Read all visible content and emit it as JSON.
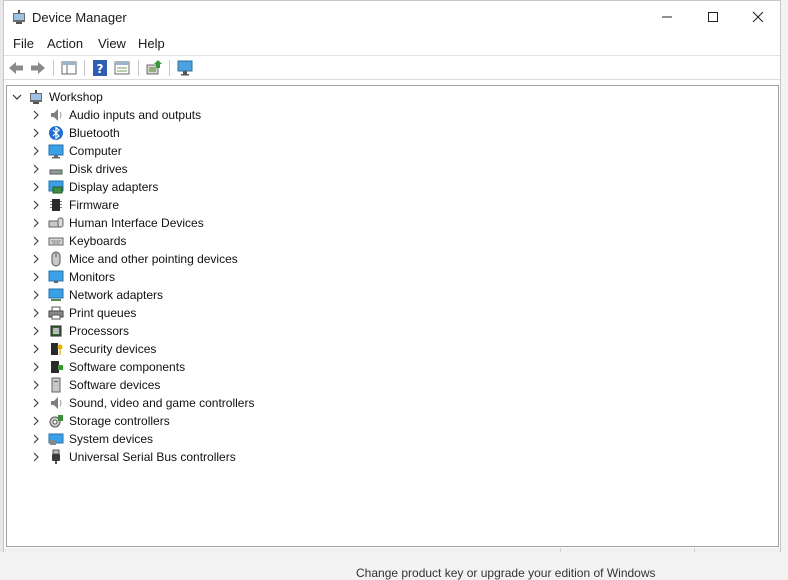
{
  "window": {
    "title": "Device Manager"
  },
  "menu": [
    "File",
    "Action",
    "View",
    "Help"
  ],
  "toolbar": {
    "buttons": [
      "back-icon",
      "forward-icon",
      "show-hide-console-tree-icon",
      "help-icon",
      "properties-icon",
      "update-driver-icon",
      "monitor-icon"
    ]
  },
  "tree": {
    "root": "Workshop",
    "categories": [
      {
        "label": "Audio inputs and outputs",
        "icon": "speaker-icon"
      },
      {
        "label": "Bluetooth",
        "icon": "bluetooth-icon"
      },
      {
        "label": "Computer",
        "icon": "computer-icon"
      },
      {
        "label": "Disk drives",
        "icon": "disk-drive-icon"
      },
      {
        "label": "Display adapters",
        "icon": "display-adapter-icon"
      },
      {
        "label": "Firmware",
        "icon": "firmware-icon"
      },
      {
        "label": "Human Interface Devices",
        "icon": "hid-icon"
      },
      {
        "label": "Keyboards",
        "icon": "keyboard-icon"
      },
      {
        "label": "Mice and other pointing devices",
        "icon": "mouse-icon"
      },
      {
        "label": "Monitors",
        "icon": "monitor-icon"
      },
      {
        "label": "Network adapters",
        "icon": "network-adapter-icon"
      },
      {
        "label": "Print queues",
        "icon": "printer-icon"
      },
      {
        "label": "Processors",
        "icon": "processor-icon"
      },
      {
        "label": "Security devices",
        "icon": "security-device-icon"
      },
      {
        "label": "Software components",
        "icon": "software-component-icon"
      },
      {
        "label": "Software devices",
        "icon": "software-device-icon"
      },
      {
        "label": "Sound, video and game controllers",
        "icon": "sound-controller-icon"
      },
      {
        "label": "Storage controllers",
        "icon": "storage-controller-icon"
      },
      {
        "label": "System devices",
        "icon": "system-devices-icon"
      },
      {
        "label": "Universal Serial Bus controllers",
        "icon": "usb-icon"
      }
    ]
  },
  "background": {
    "bottom_text": "Change product key or upgrade your edition of Windows"
  }
}
